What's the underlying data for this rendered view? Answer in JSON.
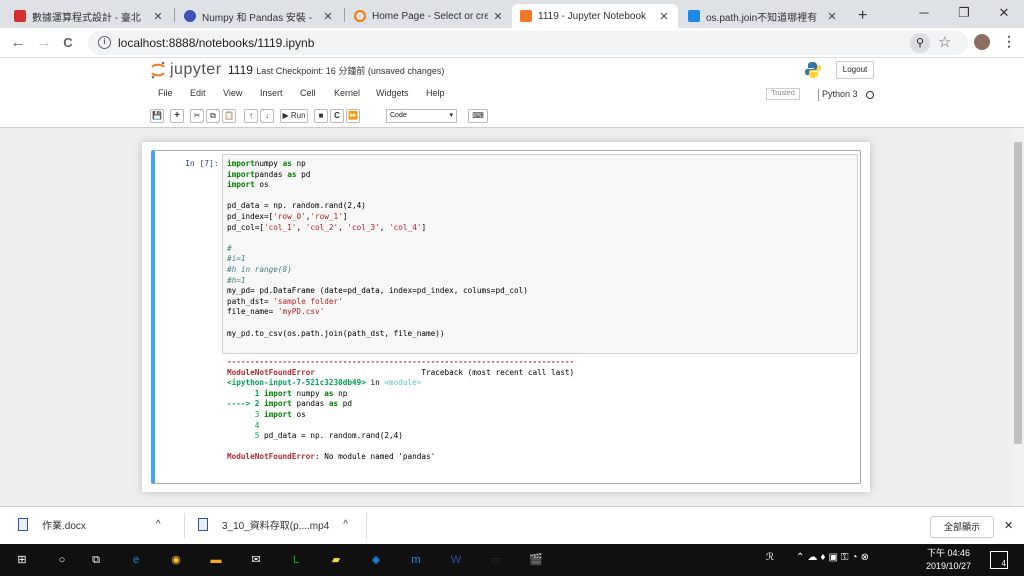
{
  "browser": {
    "tabs": [
      {
        "title": "數據運算程式設計 - 臺北",
        "icon_color": "#d32f2f",
        "active": false
      },
      {
        "title": "Numpy 和 Pandas 安裝 - ",
        "icon_color": "#3f51b5",
        "active": false
      },
      {
        "title": "Home Page - Select or cre",
        "icon_color": "#f57c00",
        "active": false
      },
      {
        "title": "1119 - Jupyter Notebook",
        "icon_color": "#f37726",
        "active": true
      },
      {
        "title": "os.path.join不知道哪裡有",
        "icon_color": "#1e88e5",
        "active": false
      }
    ],
    "new_tab": "+",
    "url": "localhost:8888/notebooks/1119.ipynb",
    "window_buttons": [
      "─",
      "❐",
      "✕"
    ],
    "nav": {
      "back": "←",
      "forward": "→",
      "reload": "C"
    }
  },
  "jupyter": {
    "logo_text": "jupyter",
    "notebook_name": "1119",
    "checkpoint": "Last Checkpoint: 16 分鐘前  (unsaved changes)",
    "logout": "Logout",
    "menu": [
      "File",
      "Edit",
      "View",
      "Insert",
      "Cell",
      "Kernel",
      "Widgets",
      "Help"
    ],
    "trusted": "Trusted",
    "kernel": "Python 3",
    "toolbar": {
      "buttons": [
        "💾",
        "+",
        "✂",
        "⧉",
        "📋",
        "↑",
        "↓"
      ],
      "run": "▶ Run",
      "after": [
        "■",
        "C",
        "⏩"
      ],
      "cell_type": "Code",
      "keyboard": "⌨"
    }
  },
  "cell": {
    "prompt": "In [7]:",
    "code_lines": [
      [
        [
          "kw",
          "import"
        ],
        [
          "",
          "numpy "
        ],
        [
          "kw",
          "as"
        ],
        [
          "",
          " np"
        ]
      ],
      [
        [
          "kw",
          "import"
        ],
        [
          "",
          "pandas "
        ],
        [
          "kw",
          "as"
        ],
        [
          "",
          " pd"
        ]
      ],
      [
        [
          "kw",
          "import"
        ],
        [
          "",
          " os"
        ]
      ],
      [],
      [
        [
          "",
          "pd_data = np. random.rand(2,4)"
        ]
      ],
      [
        [
          "",
          "pd_index=["
        ],
        [
          "st",
          "'row_0'"
        ],
        [
          "",
          ","
        ],
        [
          "st",
          "'row_1'"
        ],
        [
          "",
          "]"
        ]
      ],
      [
        [
          "",
          "pd_col=["
        ],
        [
          "st",
          "'col_1'"
        ],
        [
          "",
          ", "
        ],
        [
          "st",
          "'col_2'"
        ],
        [
          "",
          ", "
        ],
        [
          "st",
          "'col_3'"
        ],
        [
          "",
          ", "
        ],
        [
          "st",
          "'col_4'"
        ],
        [
          "",
          "]"
        ]
      ],
      [],
      [
        [
          "cm",
          "#"
        ]
      ],
      [
        [
          "cm",
          "#i=1"
        ]
      ],
      [
        [
          "cm",
          "#h in range(8)"
        ]
      ],
      [
        [
          "cm",
          "#h=1"
        ]
      ],
      [
        [
          "",
          "my_pd= pd.DataFrame (date=pd_data, index=pd_index, colums=pd_col)"
        ]
      ],
      [
        [
          "",
          "path_dst= "
        ],
        [
          "st",
          "'sample folder'"
        ]
      ],
      [
        [
          "",
          "file_name= "
        ],
        [
          "st",
          "'myPD.csv'"
        ]
      ],
      [],
      [
        [
          "",
          "my_pd.to_csv(os.path.join(path_dst, file_name))"
        ]
      ]
    ],
    "output_lines": [
      [
        [
          "er",
          "---------------------------------------------------------------------------"
        ]
      ],
      [
        [
          "er",
          "ModuleNotFoundError"
        ],
        [
          "",
          "                       Traceback (most recent call last)"
        ]
      ],
      [
        [
          "gb",
          "<ipython-input-7-521c3230db49>"
        ],
        [
          "",
          " in "
        ],
        [
          "cy",
          "<module>"
        ]
      ],
      [
        [
          "gb",
          "      1 "
        ],
        [
          "kw",
          "import"
        ],
        [
          "",
          " numpy "
        ],
        [
          "kw",
          "as"
        ],
        [
          "",
          " np"
        ]
      ],
      [
        [
          "gb",
          "----> 2 "
        ],
        [
          "kw",
          "import"
        ],
        [
          "",
          " pandas "
        ],
        [
          "kw",
          "as"
        ],
        [
          "",
          " pd"
        ]
      ],
      [
        [
          "gr",
          "      3 "
        ],
        [
          "kw",
          "import"
        ],
        [
          "",
          " os"
        ]
      ],
      [
        [
          "gr",
          "      4"
        ]
      ],
      [
        [
          "gr",
          "      5 "
        ],
        [
          "",
          "pd_data = np. random.rand(2,4)"
        ]
      ],
      [],
      [
        [
          "er",
          "ModuleNotFoundError"
        ],
        [
          "",
          ": No module named 'pandas'"
        ]
      ]
    ]
  },
  "downloads": {
    "items": [
      "作業.docx",
      "3_10_資料存取(p....mp4"
    ],
    "show_all": "全部顯示",
    "close": "✕"
  },
  "taskbar": {
    "time": "下午 04:46",
    "date": "2019/10/27",
    "notifications": "4",
    "apps": [
      {
        "icon": "⊞",
        "color": "#ffffff"
      },
      {
        "icon": "○",
        "color": "#ffffff"
      },
      {
        "icon": "⧉",
        "color": "#ffffff"
      },
      {
        "icon": "e",
        "color": "#1e88e5"
      },
      {
        "icon": "◉",
        "color": "#fbc02d"
      },
      {
        "icon": "▬",
        "color": "#f9a825"
      },
      {
        "icon": "✉",
        "color": "#ffffff"
      },
      {
        "icon": "L",
        "color": "#00c300"
      },
      {
        "icon": "▰",
        "color": "#fdd835"
      },
      {
        "icon": "◆",
        "color": "#1976d2"
      },
      {
        "icon": "m",
        "color": "#2196f3"
      },
      {
        "icon": "W",
        "color": "#2b579a"
      },
      {
        "icon": "▭",
        "color": "#333333"
      },
      {
        "icon": "🎬",
        "color": "#ffffff"
      }
    ]
  }
}
